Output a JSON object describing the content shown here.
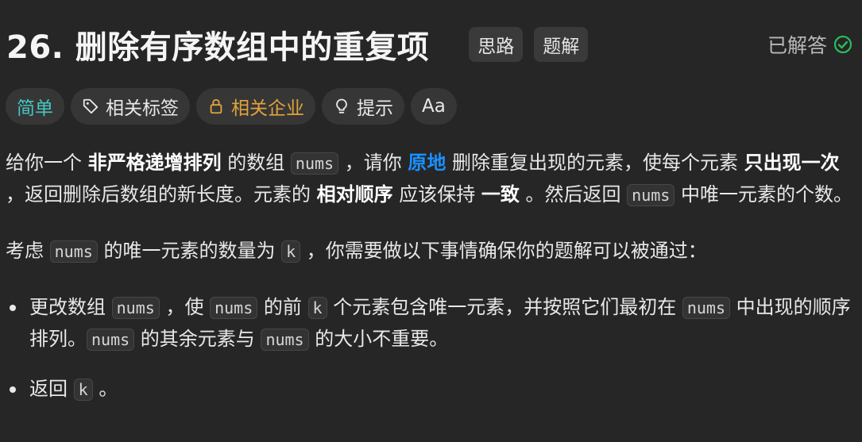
{
  "header": {
    "title": "26. 删除有序数组中的重复项",
    "chip_hints": "思路",
    "chip_solutions": "题解",
    "status": "已解答"
  },
  "tags": {
    "difficulty": "简单",
    "topics": "相关标签",
    "companies": "相关企业",
    "hint": "提示",
    "font_toggle": "Aa"
  },
  "description": {
    "p1": {
      "t1": "给你一个 ",
      "b1": "非严格递增排列",
      "t2": " 的数组 ",
      "c1": "nums",
      "t3": " ，请你 ",
      "l1": "原地",
      "t4": " 删除重复出现的元素，使每个元素 ",
      "b2": "只出现一次",
      "t5": " ，返回删除后数组的新长度。元素的 ",
      "b3": "相对顺序",
      "t6": " 应该保持 ",
      "b4": "一致",
      "t7": " 。然后返回 ",
      "c2": "nums",
      "t8": " 中唯一元素的个数。"
    },
    "p2": {
      "t1": "考虑 ",
      "c1": "nums",
      "t2": " 的唯一元素的数量为 ",
      "c2": "k",
      "t3": " ，你需要做以下事情确保你的题解可以被通过："
    },
    "bullet1": {
      "t1": "更改数组 ",
      "c1": "nums",
      "t2": " ，使 ",
      "c2": "nums",
      "t3": " 的前 ",
      "c3": "k",
      "t4": " 个元素包含唯一元素，并按照它们最初在 ",
      "c4": "nums",
      "t5": " 中出现的顺序排列。",
      "c5": "nums",
      "t6": " 的其余元素与 ",
      "c6": "nums",
      "t7": " 的大小不重要。"
    },
    "bullet2": {
      "t1": "返回 ",
      "c1": "k",
      "t2": " 。"
    }
  },
  "colors": {
    "background": "#262626",
    "easy": "#46c6c2",
    "company_locked": "#e0a33b",
    "link_blue": "#1a90ff",
    "solved_check": "#2cbb5d"
  },
  "icons": [
    "check-circle-icon",
    "tag-icon",
    "lock-icon",
    "lightbulb-icon",
    "font-size-icon"
  ]
}
